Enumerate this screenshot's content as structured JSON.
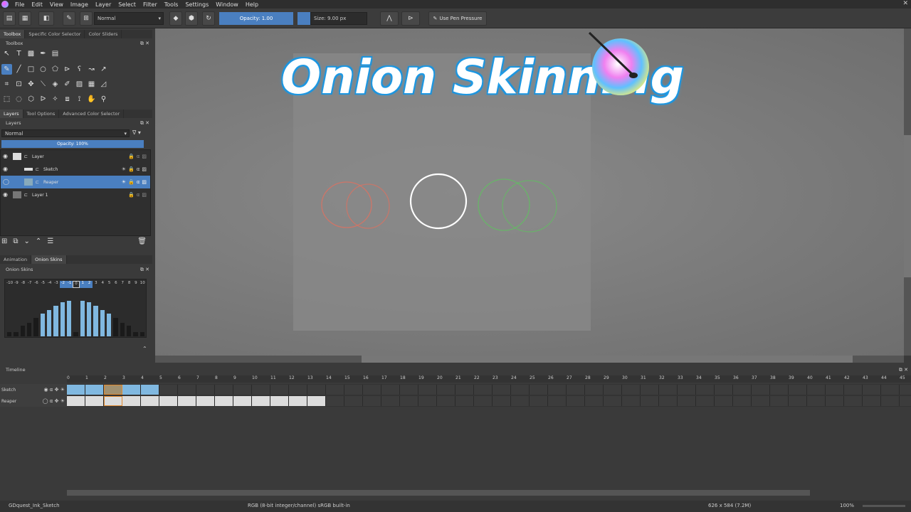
{
  "menu": [
    "File",
    "Edit",
    "View",
    "Image",
    "Layer",
    "Select",
    "Filter",
    "Tools",
    "Settings",
    "Window",
    "Help"
  ],
  "toolbar": {
    "blend_mode": "Normal",
    "opacity_label": "Opacity: 1.00",
    "size_label": "Size: 9.00 px",
    "pen_pressure_label": "Use Pen Pressure"
  },
  "dock_tabs_top": [
    "Toolbox",
    "Specific Color Selector",
    "Color Sliders"
  ],
  "toolbox_title": "Toolbox",
  "dock_tabs_mid": [
    "Layers",
    "Tool Options",
    "Advanced Color Selector"
  ],
  "layers": {
    "title": "Layers",
    "blend_mode": "Normal",
    "opacity_label": "Opacity: 100%",
    "items": [
      {
        "name": "Layer",
        "selected": false
      },
      {
        "name": "Sketch",
        "selected": false
      },
      {
        "name": "Reaper",
        "selected": true
      },
      {
        "name": "Layer 1",
        "selected": false
      }
    ]
  },
  "dock_tabs_bottom": [
    "Animation",
    "Onion Skins"
  ],
  "onion": {
    "title": "Onion Skins",
    "numbers": [
      "-10",
      "-9",
      "-8",
      "-7",
      "-6",
      "-5",
      "-4",
      "-3",
      "-2",
      "-1",
      "0",
      "1",
      "2",
      "3",
      "4",
      "5",
      "6",
      "7",
      "8",
      "9",
      "10"
    ],
    "levels": [
      0,
      0,
      0.2,
      0.3,
      0.45,
      0.6,
      0.7,
      0.85,
      0.95,
      1,
      0,
      1,
      0.95,
      0.85,
      0.7,
      0.6,
      0.45,
      0.3,
      0.2,
      0,
      0
    ]
  },
  "canvas_title": "Onion Skinning",
  "colors": {
    "accent": "#4a7fc0",
    "past_onion": "#e07060",
    "future_onion": "#60c060"
  },
  "timeline": {
    "title": "Timeline",
    "frame_numbers": [
      "0",
      "1",
      "2",
      "3",
      "4",
      "5",
      "6",
      "7",
      "8",
      "9",
      "10",
      "11",
      "12",
      "13",
      "14",
      "15",
      "16",
      "17",
      "18",
      "19",
      "20",
      "21",
      "22",
      "23",
      "24",
      "25",
      "26",
      "27",
      "28",
      "29",
      "30",
      "31",
      "32",
      "33",
      "34",
      "35",
      "36",
      "37",
      "38",
      "39",
      "40",
      "41",
      "42",
      "43",
      "44",
      "45"
    ],
    "tracks": [
      {
        "name": "Sketch",
        "filled_frames": 5
      },
      {
        "name": "Reaper",
        "filled_frames": 14
      }
    ],
    "current_frame": 2
  },
  "status": {
    "document": "GDquest_Ink_Sketch",
    "color_space": "RGB (8-bit integer/channel)  sRGB built-in",
    "dimensions": "626 x 584 (7.2M)",
    "zoom": "100%"
  }
}
